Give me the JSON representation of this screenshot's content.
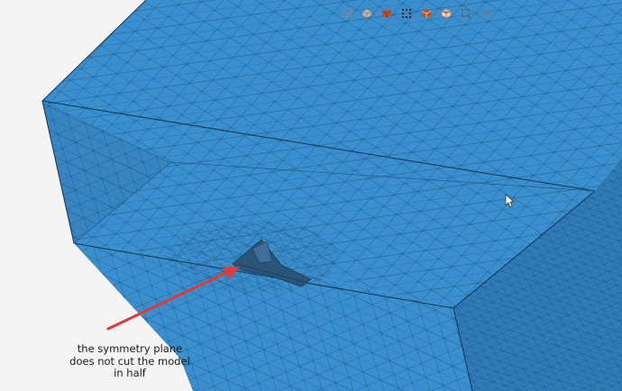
{
  "toolbar": {
    "buttons": [
      {
        "icon": "view-cube-icon",
        "color": "#8a8a8a"
      },
      {
        "icon": "shaded-cube-icon",
        "color": "#8a8a8a"
      },
      {
        "icon": "colored-cube-icon",
        "color": "#c0502a"
      },
      {
        "icon": "mesh-nodes-icon",
        "color": "#2b2b2b"
      },
      {
        "icon": "colored-cube-alt-icon",
        "color": "#c0502a"
      },
      {
        "icon": "wireframe-cube-icon",
        "color": "#c57a5a"
      },
      {
        "icon": "box-select-icon",
        "color": "#5a5a5a"
      },
      {
        "icon": "settings-icon",
        "color": "#7a7a7a"
      }
    ]
  },
  "annotation": {
    "lines": [
      "the symmetry plane",
      "does not cut the model",
      "in half"
    ],
    "arrow_color": "#e03a3a"
  },
  "colors": {
    "mesh_face": "#3a8fcf",
    "mesh_face_dark": "#2f7cb8",
    "mesh_edge": "#1b4f77",
    "aircraft": "#2a5578",
    "background": "#f4f4f4"
  }
}
